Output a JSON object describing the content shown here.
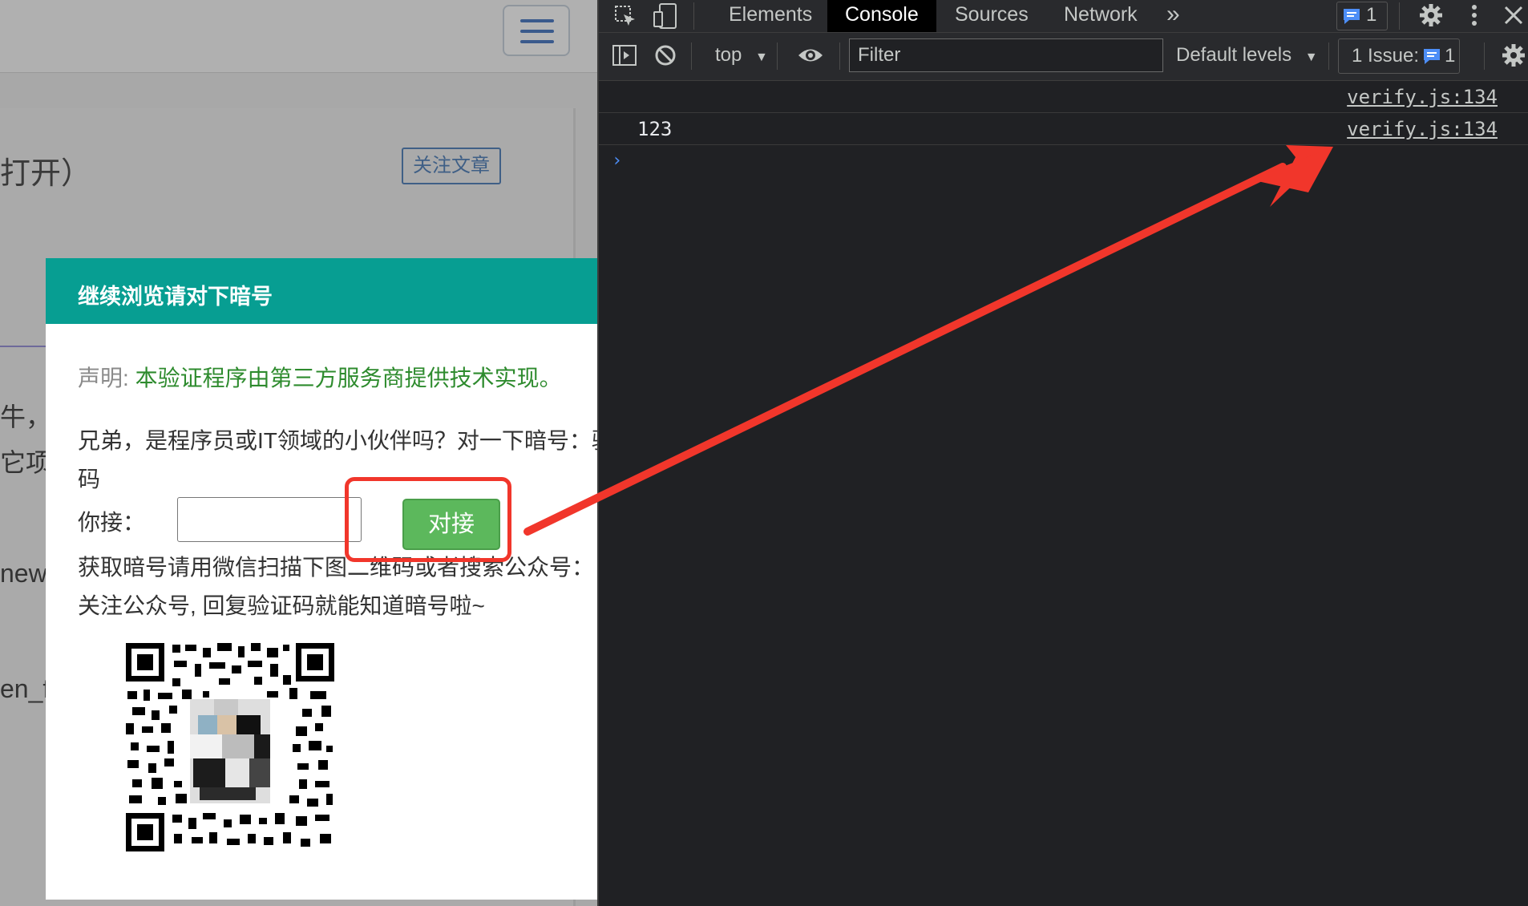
{
  "webpage": {
    "article_title_fragment": "打开）",
    "follow_article_label": "关注文章",
    "fragments": [
      "牛，徝",
      "它项",
      "new",
      "en_f"
    ]
  },
  "modal": {
    "title": "继续浏览请对下暗号",
    "disclaimer_label": "声明:",
    "disclaimer_text": "本验证程序由第三方服务商提供技术实现。",
    "question_line1": "兄弟，是程序员或IT领域的小伙伴吗？对一下暗号：验",
    "question_line2": "码",
    "answer_label": "你接：",
    "answer_value": "",
    "connect_button": "对接",
    "help_line1": "获取暗号请用微信扫描下图二维码或者搜索公众号：",
    "help_line2": "关注公众号, 回复验证码就能知道暗号啦~"
  },
  "devtools": {
    "tabs": [
      "Elements",
      "Console",
      "Sources",
      "Network"
    ],
    "active_tab": "Console",
    "more_tabs_glyph": "»",
    "issues_badge_count": "1",
    "context": "top",
    "filter_placeholder": "Filter",
    "levels": "Default levels",
    "issues_label": "1 Issue:",
    "issues_count": "1",
    "console_rows": [
      {
        "value": "",
        "source": "verify.js:134"
      },
      {
        "value": "123",
        "source": "verify.js:134"
      }
    ],
    "prompt_glyph": "›"
  },
  "annotation": {
    "color": "#f1362b"
  }
}
